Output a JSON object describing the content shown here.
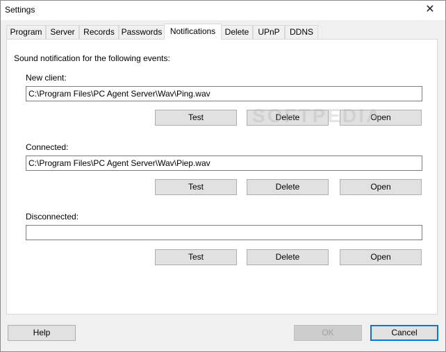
{
  "window": {
    "title": "Settings",
    "close_glyph": "✕"
  },
  "tabs": [
    {
      "label": "Program"
    },
    {
      "label": "Server"
    },
    {
      "label": "Records"
    },
    {
      "label": "Passwords"
    },
    {
      "label": "Notifications"
    },
    {
      "label": "Delete"
    },
    {
      "label": "UPnP"
    },
    {
      "label": "DDNS"
    }
  ],
  "active_tab": "Notifications",
  "notifications": {
    "intro": "Sound notification for the following events:",
    "new_client": {
      "label": "New client:",
      "value": "C:\\Program Files\\PC Agent Server\\Wav\\Ping.wav"
    },
    "connected": {
      "label": "Connected:",
      "value": "C:\\Program Files\\PC Agent Server\\Wav\\Piep.wav"
    },
    "disconnected": {
      "label": "Disconnected:",
      "value": ""
    },
    "buttons": {
      "test": "Test",
      "delete": "Delete",
      "open": "Open"
    }
  },
  "watermark": "SOFTPEDIA",
  "footer": {
    "help": "Help",
    "ok": "OK",
    "cancel": "Cancel"
  }
}
